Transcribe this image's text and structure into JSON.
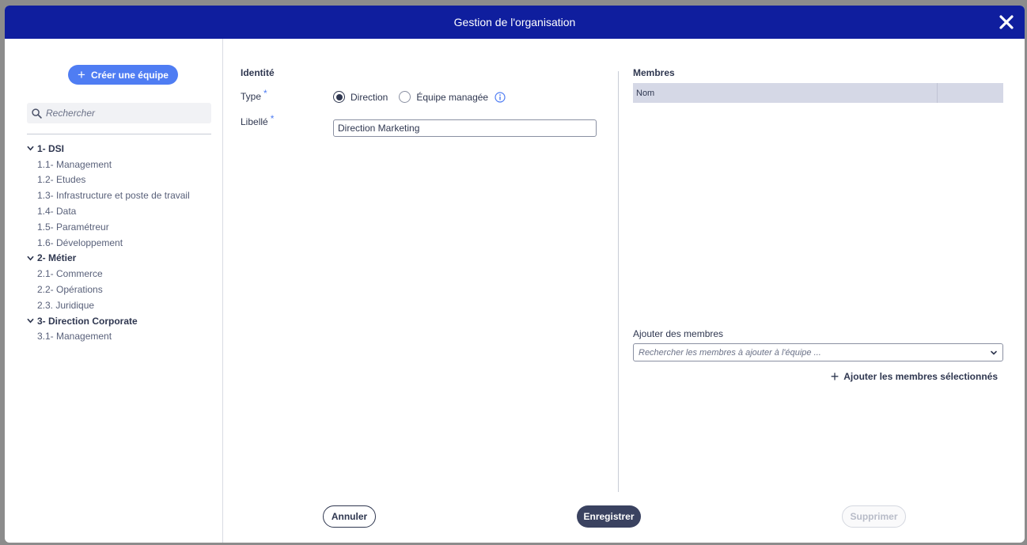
{
  "modal": {
    "title": "Gestion de l'organisation"
  },
  "left": {
    "create_team_label": "Créer une équipe",
    "search_placeholder": "Rechercher",
    "tree": [
      {
        "label": "1- DSI",
        "children": [
          "1.1- Management",
          "1.2- Etudes",
          "1.3- Infrastructure et poste de travail",
          "1.4- Data",
          "1.5- Paramétreur",
          "1.6- Développement"
        ]
      },
      {
        "label": "2- Métier",
        "children": [
          "2.1- Commerce",
          "2.2- Opérations",
          "2.3. Juridique"
        ]
      },
      {
        "label": "3- Direction Corporate",
        "children": [
          "3.1- Management"
        ]
      }
    ]
  },
  "identity": {
    "section_title": "Identité",
    "type_label": "Type",
    "required_mark": "*",
    "radio_direction": "Direction",
    "radio_managed_team": "Équipe managée",
    "selected_type": "Direction",
    "libelle_label": "Libellé",
    "libelle_value": "Direction Marketing"
  },
  "members": {
    "section_title": "Membres",
    "column_nom": "Nom",
    "add_title": "Ajouter des membres",
    "add_placeholder": "Rechercher les membres à ajouter à l'équipe ...",
    "add_selected_label": "Ajouter les membres sélectionnés"
  },
  "footer": {
    "cancel_label": "Annuler",
    "save_label": "Enregistrer",
    "delete_label": "Supprimer"
  },
  "colors": {
    "header": "#0f1e9e",
    "accent": "#4f7df3",
    "primary_button": "#3a4260"
  }
}
